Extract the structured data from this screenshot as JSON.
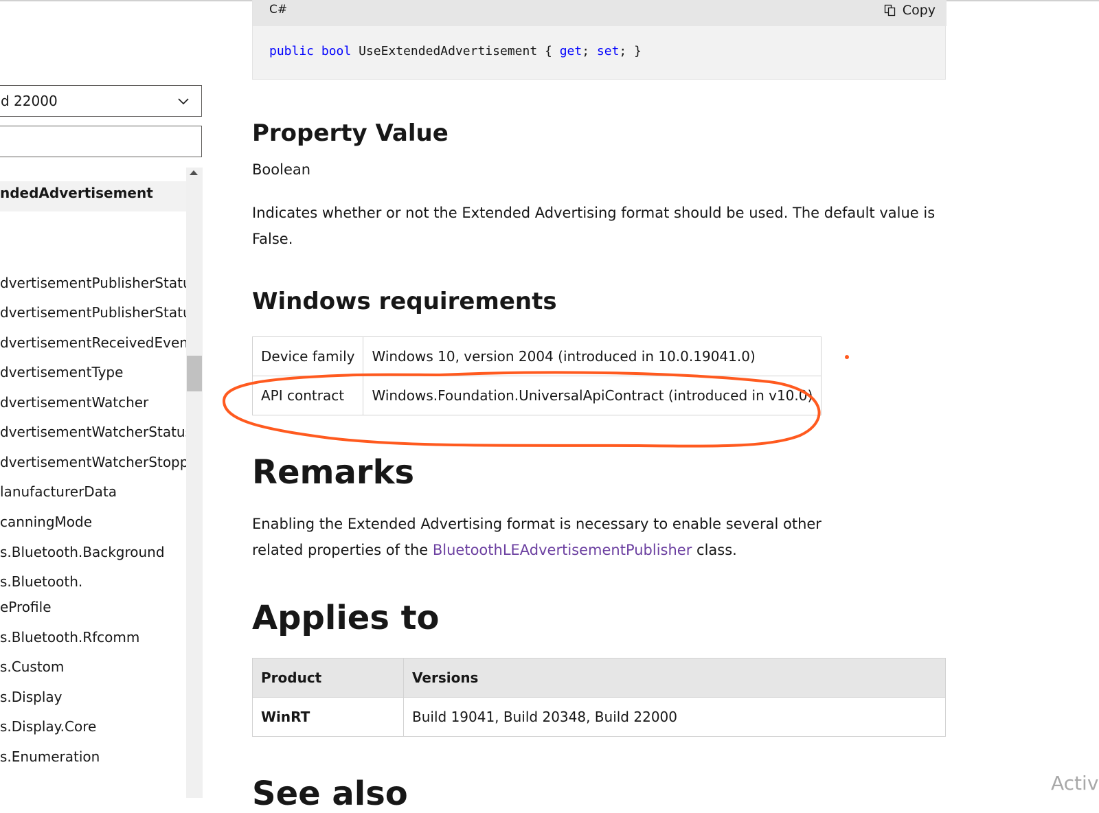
{
  "sidebar": {
    "version_selected": "d 22000",
    "filter_value": "",
    "toc": [
      "ndedAdvertisement",
      "dvertisementPublisherStatus",
      "dvertisementPublisherStatusC",
      "dvertisementReceivedEventAr",
      "dvertisementType",
      "dvertisementWatcher",
      "dvertisementWatcherStatus",
      "dvertisementWatcherStoppec",
      "lanufacturerData",
      "canningMode",
      "s.Bluetooth.Background",
      "s.Bluetooth.",
      "eProfile",
      "s.Bluetooth.Rfcomm",
      "s.Custom",
      "s.Display",
      "s.Display.Core",
      "s.Enumeration"
    ]
  },
  "code": {
    "language": "C#",
    "copy_label": "Copy",
    "kw_public": "public",
    "kw_bool": "bool",
    "name": "UseExtendedAdvertisement",
    "open": "{",
    "kw_get": "get",
    "semi1": ";",
    "kw_set": "set",
    "semi2": ";",
    "close": "}"
  },
  "property_value": {
    "heading": "Property Value",
    "type_link": "Boolean",
    "description": "Indicates whether or not the Extended Advertising format should be used. The default value is False."
  },
  "windows_requirements": {
    "heading": "Windows requirements",
    "rows": [
      {
        "label": "Device family",
        "value": "Windows 10, version 2004 (introduced in 10.0.19041.0)"
      },
      {
        "label": "API contract",
        "value": "Windows.Foundation.UniversalApiContract (introduced in v10.0)"
      }
    ]
  },
  "remarks": {
    "heading": "Remarks",
    "text_before": "Enabling the Extended Advertising format is necessary to enable several other related properties of the",
    "link": "BluetoothLEAdvertisementPublisher",
    "text_after": "class."
  },
  "applies_to": {
    "heading": "Applies to",
    "columns": [
      "Product",
      "Versions"
    ],
    "rows": [
      {
        "product": "WinRT",
        "versions": "Build 19041, Build 20348, Build 22000"
      }
    ]
  },
  "see_also": {
    "heading": "See also"
  },
  "watermark": "Activa",
  "colors": {
    "annotation": "#ff5a1f",
    "link": "#0065b3",
    "visited_link": "#6b3fa0"
  }
}
